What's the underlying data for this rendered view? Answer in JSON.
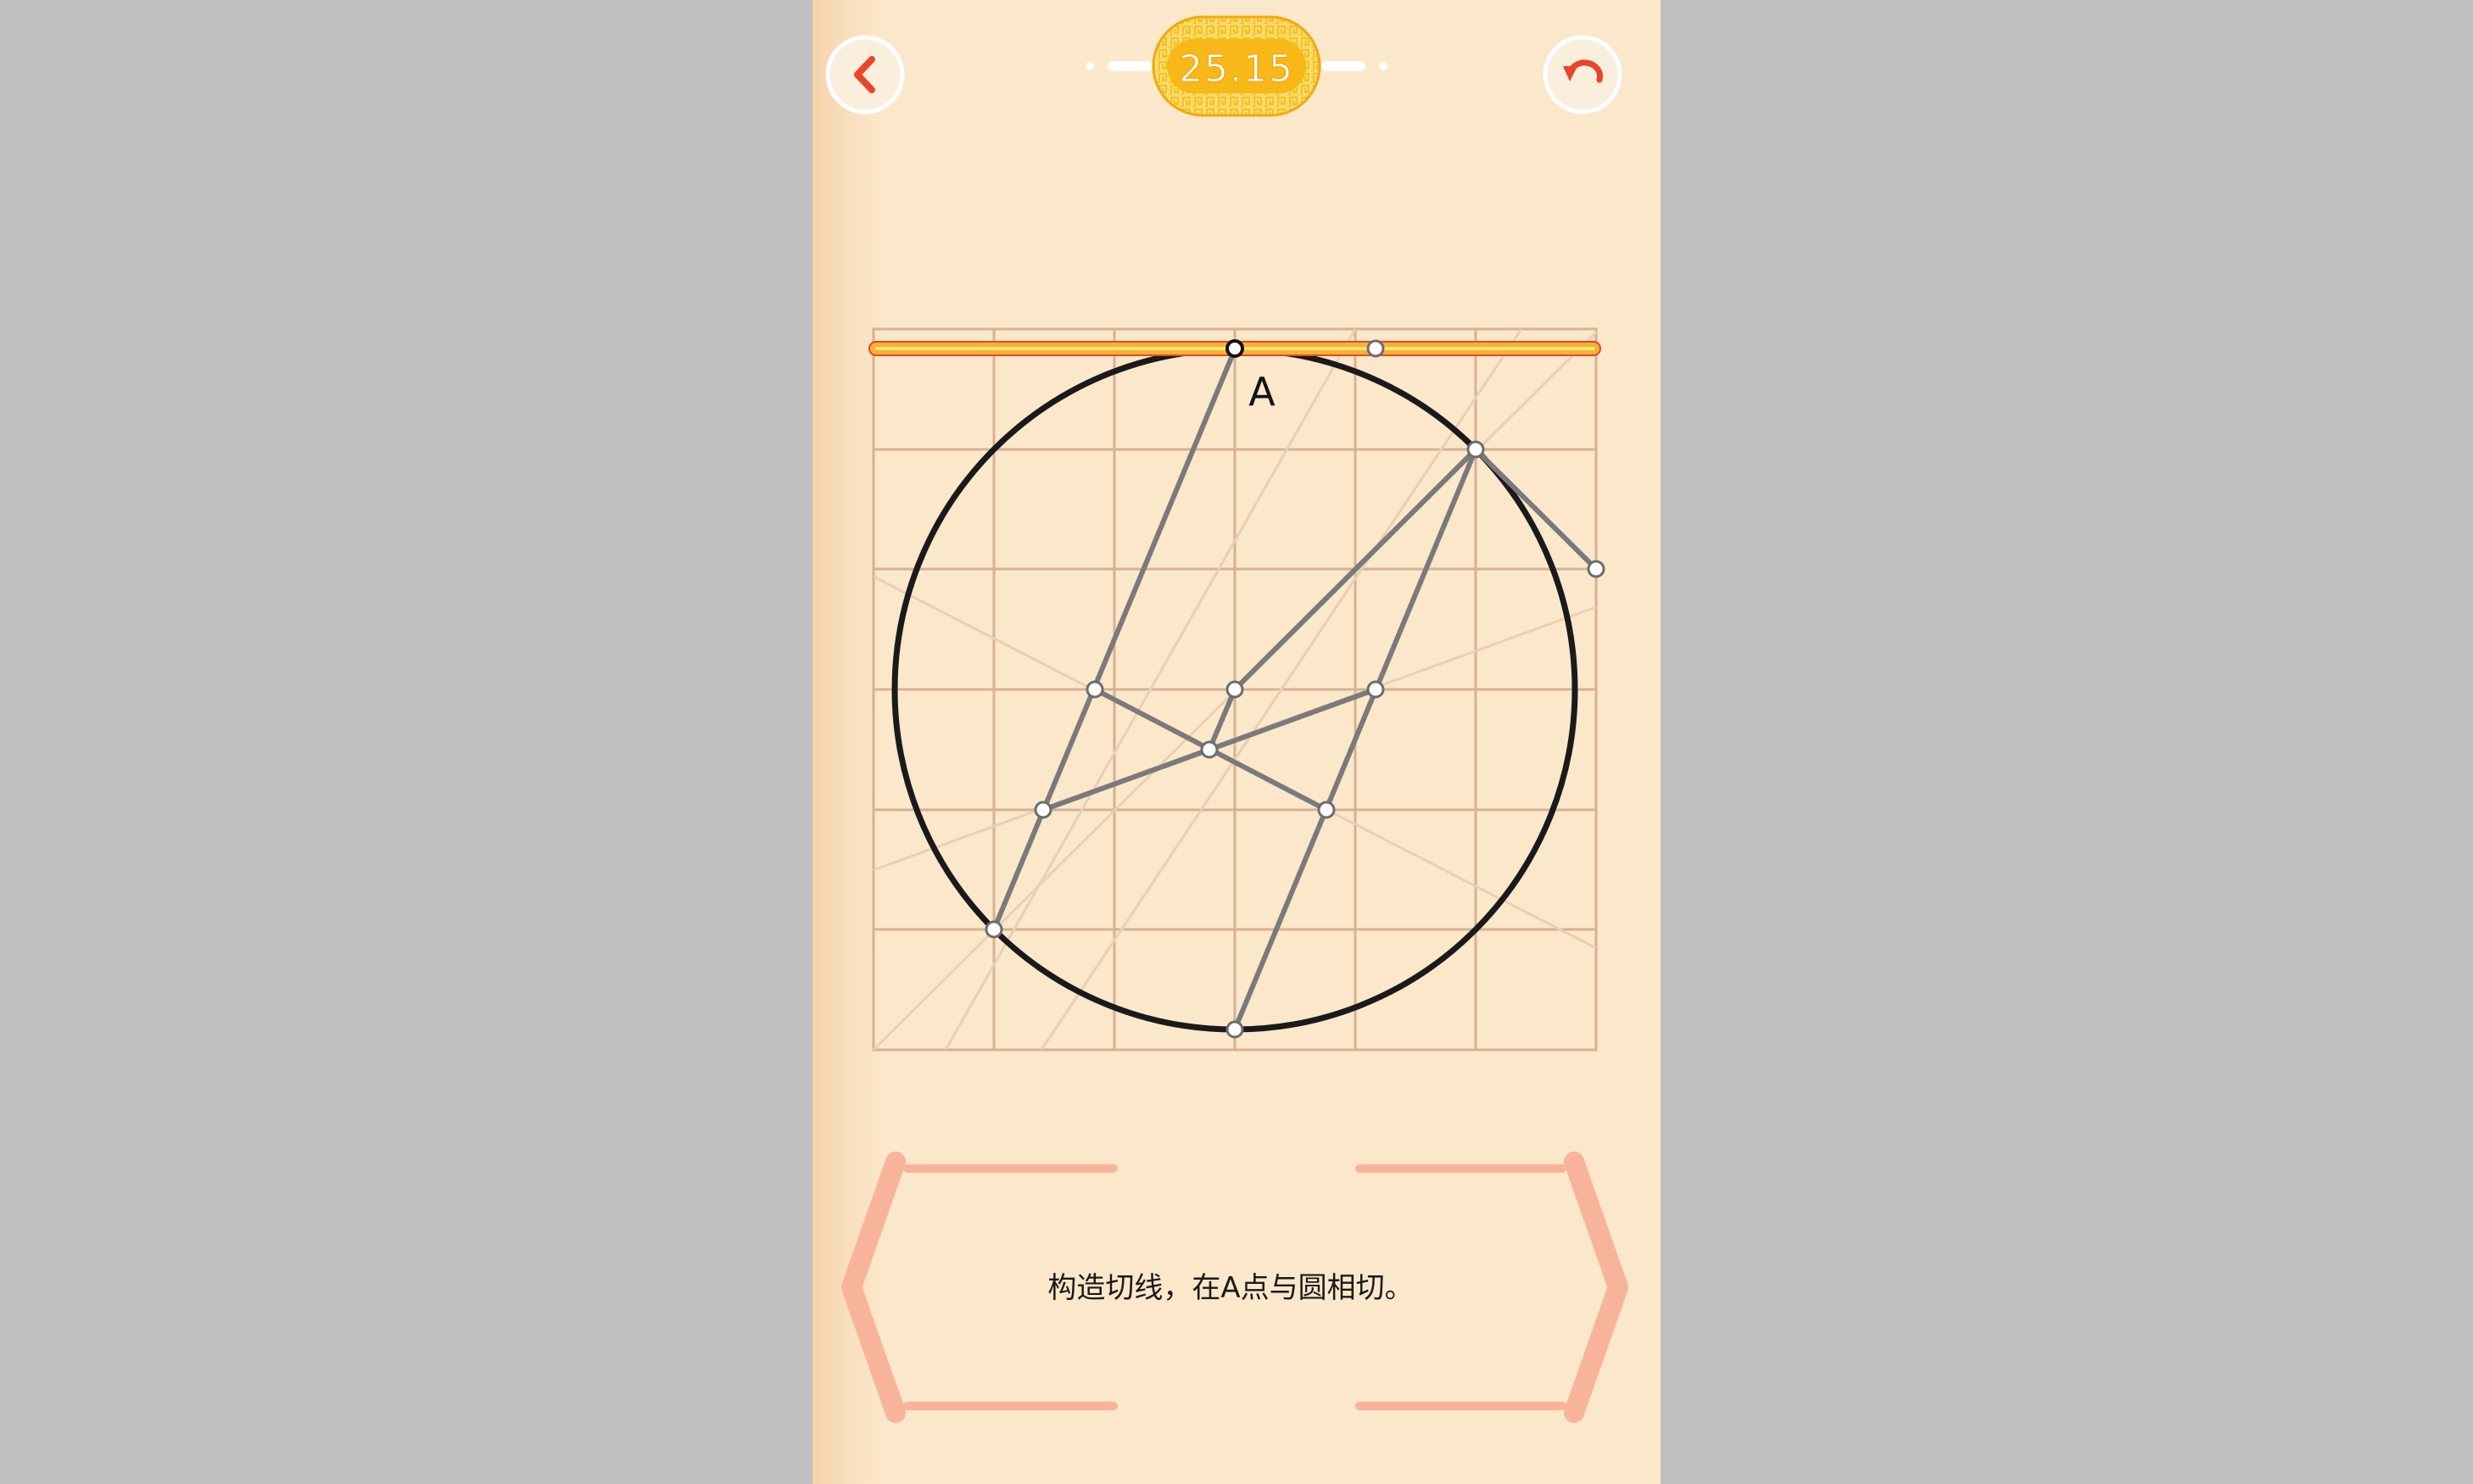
{
  "header": {
    "level_number": "25.15",
    "back_icon": "chevron-left-icon",
    "undo_icon": "undo-arrow-icon",
    "accent_color": "#e8452c",
    "badge_color": "#f7c31a"
  },
  "board": {
    "point_label": "A",
    "tangent_color": "#f5b52e",
    "circle_color": "#1a1a1a",
    "construction_line_color": "#7a7a7a",
    "grid_color": "#d7b195"
  },
  "instruction": {
    "text": "构造切线，在A点与圆相切。",
    "bracket_color": "#f8b49b"
  }
}
